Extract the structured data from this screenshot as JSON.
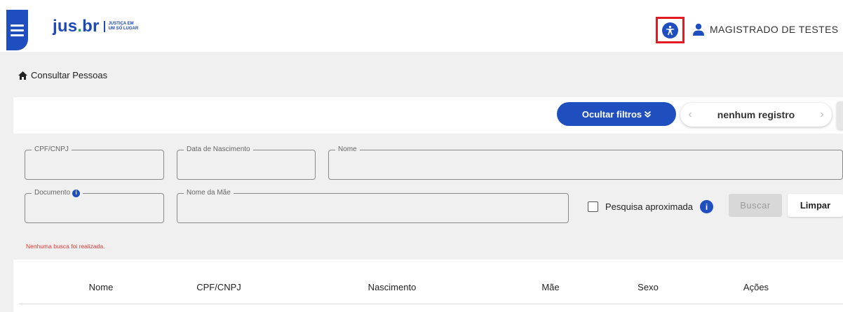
{
  "header": {
    "logo_main": "jus",
    "logo_dot": ".",
    "logo_suffix": "br",
    "logo_tag_line1": "JUSTIÇA EM",
    "logo_tag_line2": "UM SÓ LUGAR",
    "user_name": "MAGISTRADO DE TESTES",
    "accessibility_icon": "accessibility-icon",
    "user_icon": "person-icon"
  },
  "breadcrumb": {
    "icon": "home-icon",
    "label": "Consultar Pessoas"
  },
  "toolbar": {
    "filters_button": "Ocultar filtros",
    "filters_button_icon": "double-chevron-down-icon",
    "pager_text": "nenhum registro",
    "pager_prev": "‹",
    "pager_next": "›"
  },
  "filters": {
    "cpf_label": "CPF/CNPJ",
    "nascimento_label": "Data de Nascimento",
    "nome_label": "Nome",
    "documento_label": "Documento",
    "mae_label": "Nome da Mãe",
    "approx_label": "Pesquisa aproximada",
    "buscar_button": "Buscar",
    "limpar_button": "Limpar",
    "status_message": "Nenhuma busca foi realizada."
  },
  "table": {
    "columns": [
      "Nome",
      "CPF/CNPJ",
      "Nascimento",
      "Mãe",
      "Sexo",
      "Ações"
    ]
  },
  "colors": {
    "primary": "#1f4fbf",
    "brand_green": "#22a55b",
    "highlight_red": "#e21b23",
    "error_text": "#e53935"
  }
}
